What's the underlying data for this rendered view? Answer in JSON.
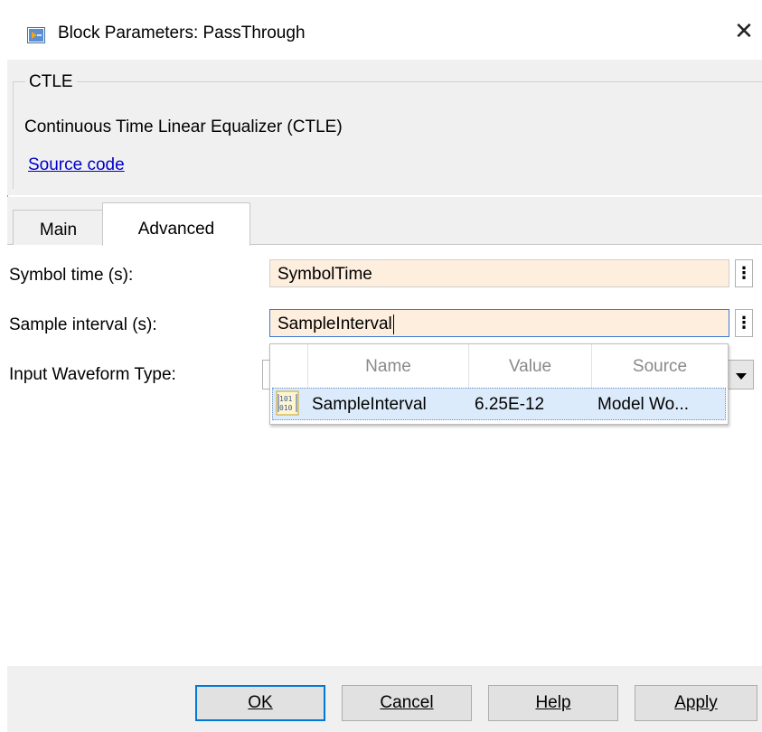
{
  "window": {
    "title": "Block Parameters: PassThrough",
    "icon": "simulink-block-icon",
    "close_label": "✕"
  },
  "description": {
    "group_label": "CTLE",
    "text": "Continuous Time Linear Equalizer (CTLE)",
    "link": "Source code"
  },
  "tabs": [
    {
      "label": "Main",
      "active": false
    },
    {
      "label": "Advanced",
      "active": true
    }
  ],
  "params": {
    "symbol_time": {
      "label": "Symbol time (s):",
      "value": "SymbolTime"
    },
    "sample_interval": {
      "label": "Sample interval (s):",
      "value": "SampleInterval"
    },
    "input_waveform": {
      "label": "Input Waveform Type:"
    }
  },
  "autocomplete": {
    "columns": [
      "Name",
      "Value",
      "Source"
    ],
    "rows": [
      {
        "name": "SampleInterval",
        "value": "6.25E-12",
        "source": "Model Wo..."
      }
    ]
  },
  "buttons": {
    "ok": "OK",
    "cancel": "Cancel",
    "help": "Help",
    "apply": "Apply"
  },
  "colors": {
    "field_bg": "#fdeedd",
    "panel_bg": "#f0f0f0",
    "selection_bg": "#dcebfb",
    "link": "#0000cc",
    "accent": "#0078d7"
  }
}
